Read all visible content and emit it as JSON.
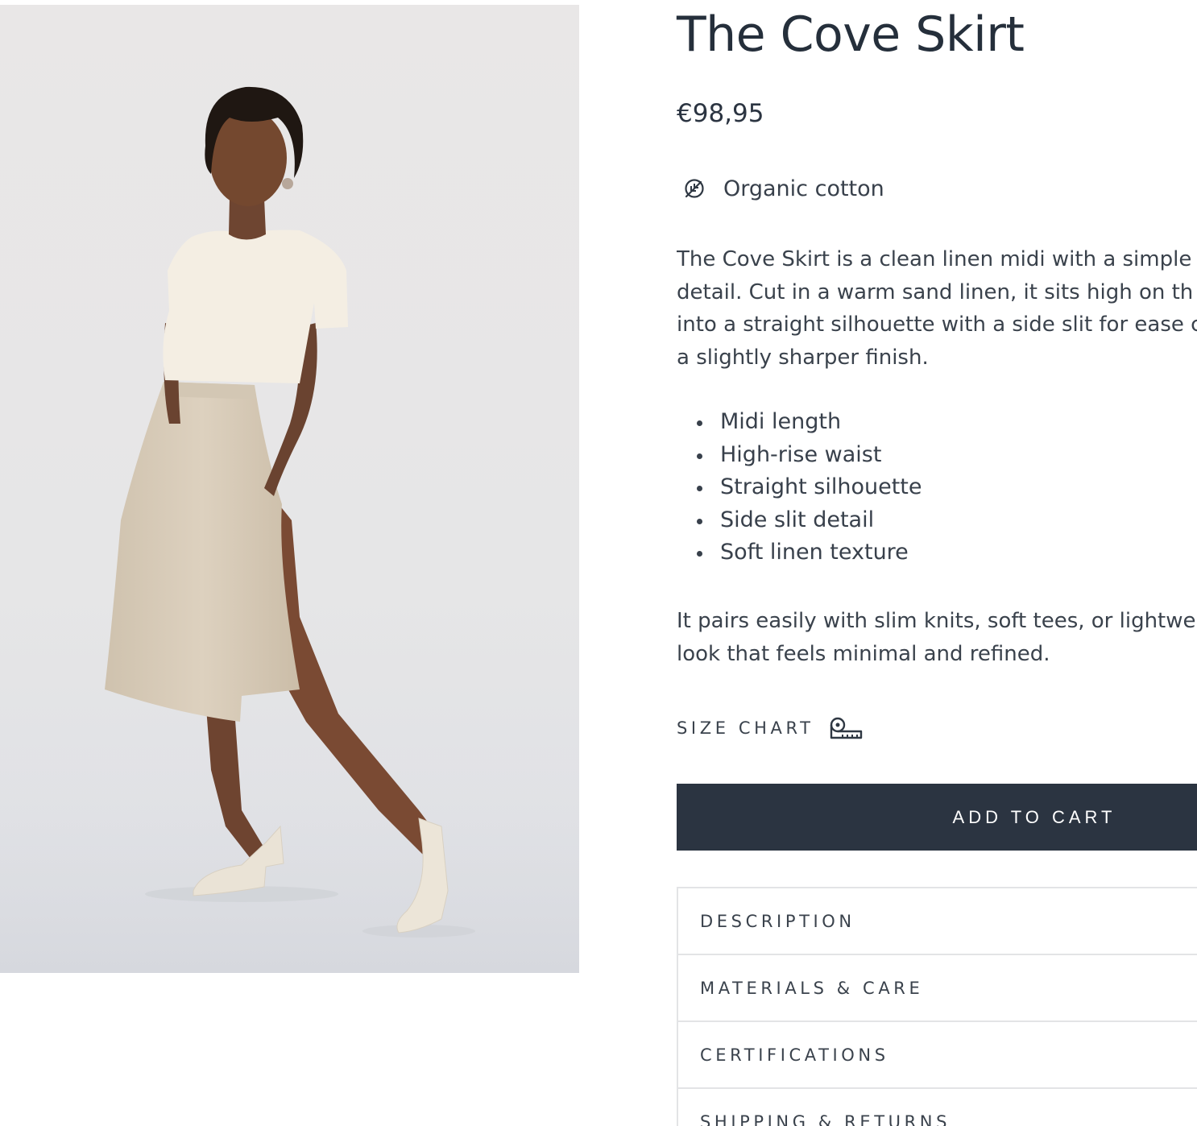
{
  "product": {
    "title": "The Cove Skirt",
    "price": "€98,95",
    "material": {
      "icon": "leaf-icon",
      "label": "Organic cotton"
    },
    "description_lines": [
      "The Cove Skirt is a clean linen midi with a simple",
      "detail. Cut in a warm sand linen, it sits high on th",
      "into a straight silhouette with a side slit for ease c",
      "a slightly sharper finish."
    ],
    "features": [
      "Midi length",
      "High-rise waist",
      "Straight silhouette",
      "Side slit detail",
      "Soft linen texture"
    ],
    "pairing_lines": [
      "It pairs easily with slim knits, soft tees, or lightwe",
      "look that feels minimal and refined."
    ]
  },
  "size_chart": {
    "label": "SIZE CHART",
    "icon": "measuring-tape-icon"
  },
  "cart": {
    "button_label": "ADD TO CART",
    "button_color": "#2b3441"
  },
  "accordion": {
    "items": [
      "DESCRIPTION",
      "MATERIALS & CARE",
      "CERTIFICATIONS",
      "SHIPPING & RETURNS"
    ]
  },
  "colors": {
    "text": "#273140",
    "divider": "#e3e4e6",
    "image_bg": "#e8e7e7"
  }
}
